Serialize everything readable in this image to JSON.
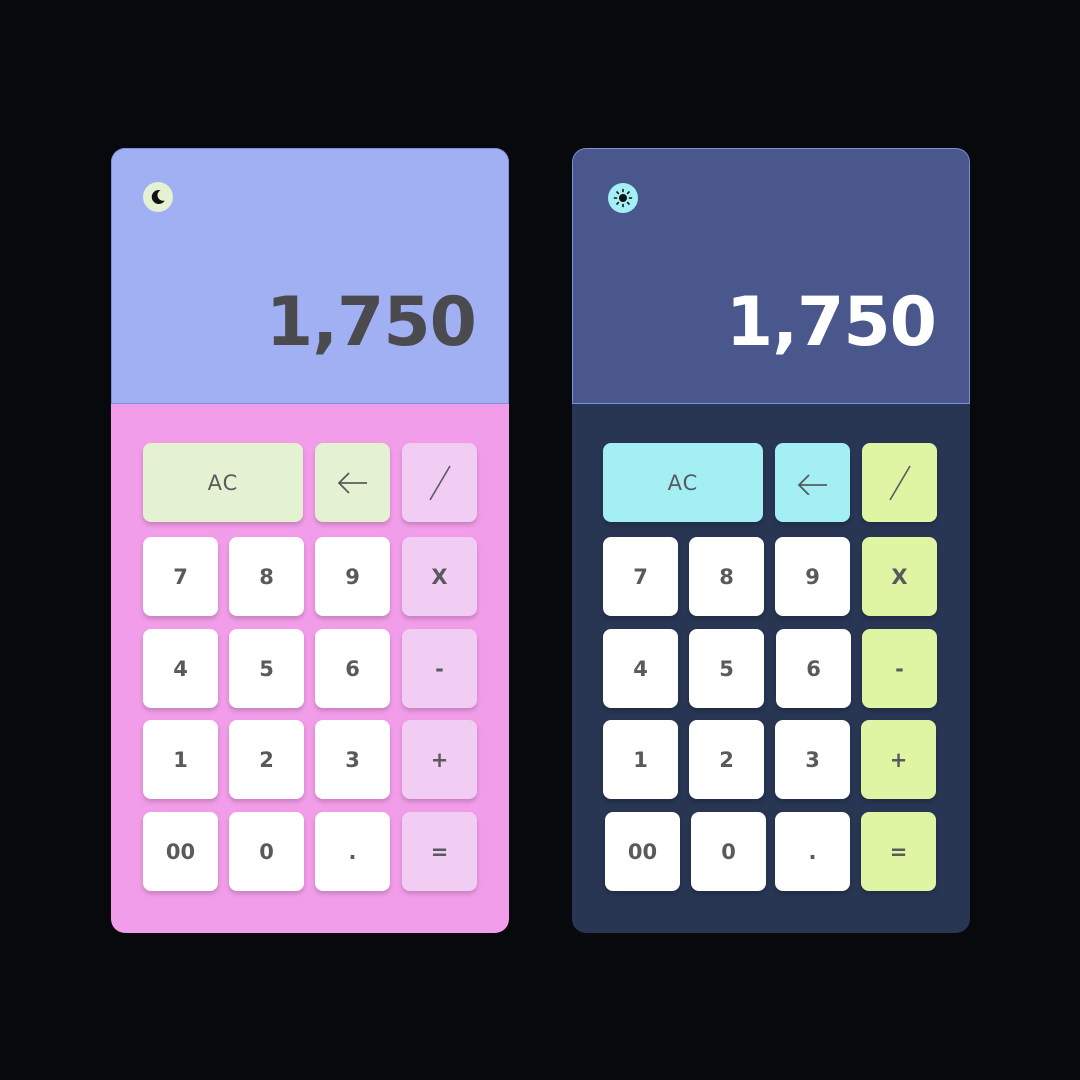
{
  "calculators": [
    {
      "theme": "light",
      "mode_icon": "moon-icon",
      "display_value": "1,750",
      "colors": {
        "body": "#f29de9",
        "screen": "#a0b0f3",
        "function_key": "#e5f1d3",
        "operator_key": "#f1cdf4",
        "text": "#4b4b4f"
      },
      "keys": {
        "clear": "AC",
        "backspace": "backspace-arrow-icon",
        "divide": "divide-slash-icon",
        "seven": "7",
        "eight": "8",
        "nine": "9",
        "multiply": "X",
        "four": "4",
        "five": "5",
        "six": "6",
        "minus": "-",
        "one": "1",
        "two": "2",
        "three": "3",
        "plus": "+",
        "double_zero": "00",
        "zero": "0",
        "decimal": ".",
        "equals": "="
      }
    },
    {
      "theme": "dark",
      "mode_icon": "sun-icon",
      "display_value": "1,750",
      "colors": {
        "body": "#283654",
        "screen": "#4a578d",
        "function_key": "#a3eff4",
        "operator_key": "#e0f5a3",
        "text": "#ffffff"
      },
      "keys": {
        "clear": "AC",
        "backspace": "backspace-arrow-icon",
        "divide": "divide-slash-icon",
        "seven": "7",
        "eight": "8",
        "nine": "9",
        "multiply": "X",
        "four": "4",
        "five": "5",
        "six": "6",
        "minus": "-",
        "one": "1",
        "two": "2",
        "three": "3",
        "plus": "+",
        "double_zero": "00",
        "zero": "0",
        "decimal": ".",
        "equals": "="
      }
    }
  ]
}
